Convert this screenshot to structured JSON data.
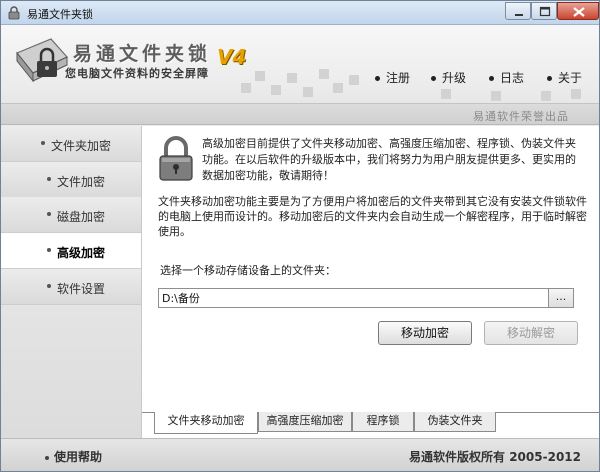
{
  "window": {
    "title": "易通文件夹锁"
  },
  "brand": {
    "title": "易通文件夹锁",
    "version": "V4",
    "slogan": "您电脑文件资料的安全屏障",
    "credit": "易通软件荣誉出品"
  },
  "topnav": [
    {
      "label": "注册"
    },
    {
      "label": "升级"
    },
    {
      "label": "日志"
    },
    {
      "label": "关于"
    }
  ],
  "sidebar": {
    "items": [
      {
        "label": "文件夹加密"
      },
      {
        "label": "文件加密"
      },
      {
        "label": "磁盘加密"
      },
      {
        "label": "高级加密"
      },
      {
        "label": "软件设置"
      }
    ]
  },
  "content": {
    "intro": "高级加密目前提供了文件夹移动加密、高强度压缩加密、程序锁、伪装文件夹功能。在以后软件的升级版本中，我们将努力为用户朋友提供更多、更实用的数据加密功能，敬请期待！",
    "description": "文件夹移动加密功能主要是为了方便用户将加密后的文件夹带到其它没有安装文件锁软件的电脑上使用而设计的。移动加密后的文件夹内会自动生成一个解密程序，用于临时解密使用。",
    "folder_label": "选择一个移动存储设备上的文件夹：",
    "path_value": "D:\\备份",
    "browse_label": "...",
    "encrypt_button": "移动加密",
    "decrypt_button": "移动解密"
  },
  "tabs": [
    {
      "label": "文件夹移动加密"
    },
    {
      "label": "高强度压缩加密"
    },
    {
      "label": "程序锁"
    },
    {
      "label": "伪装文件夹"
    }
  ],
  "footer": {
    "help": "使用帮助",
    "copyright": "易通软件版权所有 2005-2012"
  },
  "icons": {
    "app": "padlock-icon",
    "lock": "padlock-icon",
    "logo": "folder-lock-logo"
  },
  "colors": {
    "brand_accent": "#e8a200",
    "close_button": "#c9452f"
  }
}
